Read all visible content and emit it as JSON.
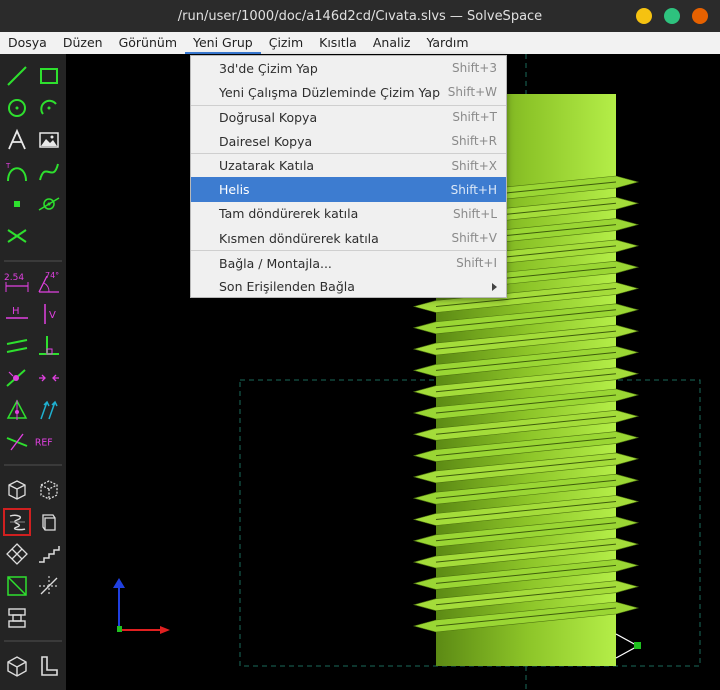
{
  "window": {
    "title": "/run/user/1000/doc/a146d2cd/Cıvata.slvs — SolveSpace"
  },
  "menubar": [
    "Dosya",
    "Düzen",
    "Görünüm",
    "Yeni Grup",
    "Çizim",
    "Kısıtla",
    "Analiz",
    "Yardım"
  ],
  "active_menu": "Yeni Grup",
  "dropdown": {
    "items": [
      {
        "label": "3d'de Çizim Yap",
        "shortcut": "Shift+3"
      },
      {
        "label": "Yeni Çalışma Düzleminde Çizim Yap",
        "shortcut": "Shift+W"
      },
      {
        "label": "Doğrusal Kopya",
        "shortcut": "Shift+T"
      },
      {
        "label": "Dairesel Kopya",
        "shortcut": "Shift+R"
      },
      {
        "label": "Uzatarak Katıla",
        "shortcut": "Shift+X"
      },
      {
        "label": "Helis",
        "shortcut": "Shift+H"
      },
      {
        "label": "Tam döndürerek katıla",
        "shortcut": "Shift+L"
      },
      {
        "label": "Kısmen döndürerek katıla",
        "shortcut": "Shift+V"
      },
      {
        "label": "Bağla / Montajla...",
        "shortcut": "Shift+I"
      },
      {
        "label": "Son Erişilenden Bağla",
        "shortcut": ""
      }
    ],
    "highlighted": "Helis"
  },
  "toolbar_text": {
    "dimension": "2.54",
    "angle": "74°",
    "horizontal": "H",
    "vertical": "V",
    "reference": "REF"
  },
  "icons": [
    "line-icon",
    "rectangle-icon",
    "circle-icon",
    "arc-icon",
    "text-icon",
    "image-icon",
    "tangent-arc-icon",
    "spline-icon",
    "point-icon",
    "construction-icon",
    "split-icon",
    "dimension-icon",
    "angle-icon",
    "horizontal-icon",
    "vertical-icon",
    "parallel-icon",
    "perpendicular-icon",
    "point-on-icon",
    "equal-icon",
    "symmetric-icon",
    "same-orientation-icon",
    "trim-icon",
    "reference-icon",
    "nearest-iso-icon",
    "nearest-ortho-icon",
    "helix-icon",
    "revolve-icon",
    "solid-mesh-icon",
    "stepped-icon",
    "hidden-line-icon",
    "ghost-icon",
    "assembly-icon",
    "workplane-icon",
    "solid-icon",
    "outline-icon"
  ],
  "colors": {
    "model": "#a8e23c",
    "model_dark": "#6e9a1c",
    "highlight": "#3d7cd0",
    "axis_x": "#e02020",
    "axis_y": "#2040e0",
    "axis_z": "#20c020",
    "workplane": "#1a6a5a",
    "tool_magenta": "#e040e0"
  }
}
